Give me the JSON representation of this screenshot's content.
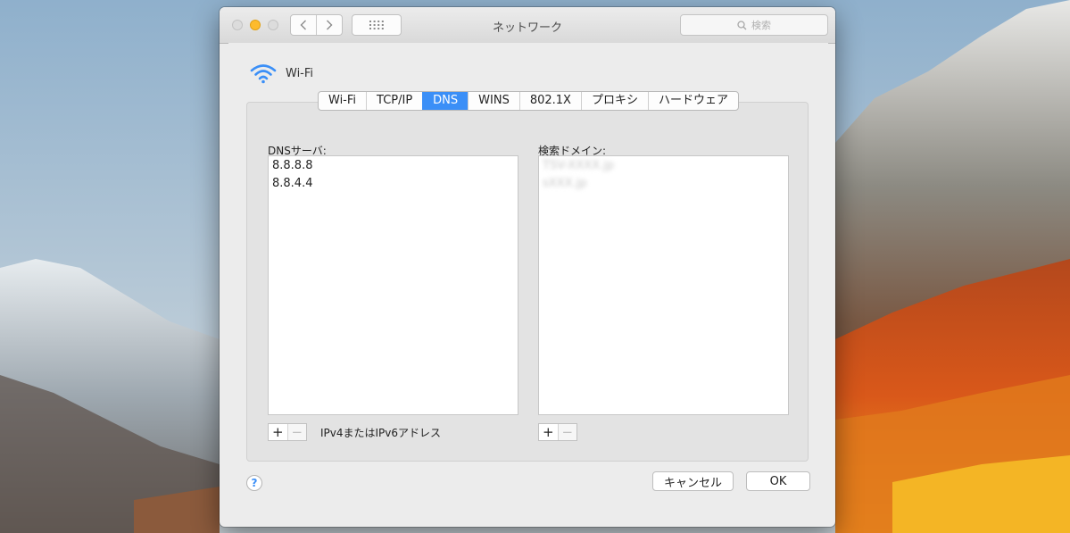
{
  "window": {
    "title": "ネットワーク"
  },
  "toolbar": {
    "back_icon": "chevron-left-icon",
    "forward_icon": "chevron-right-icon",
    "show_all_icon": "grid-icon"
  },
  "search": {
    "placeholder": "検索"
  },
  "interface": {
    "name": "Wi-Fi",
    "icon": "wifi-icon"
  },
  "tabs": [
    "Wi-Fi",
    "TCP/IP",
    "DNS",
    "WINS",
    "802.1X",
    "プロキシ",
    "ハードウェア"
  ],
  "active_tab": "DNS",
  "dns": {
    "label": "DNSサーバ:",
    "servers": [
      "8.8.8.8",
      "8.8.4.4"
    ],
    "add_label": "+",
    "remove_label": "−",
    "hint": "IPv4またはIPv6アドレス"
  },
  "search_domains": {
    "label": "検索ドメイン:",
    "domains": [
      "TSV-XXXX.jp",
      "sXXX.jp"
    ],
    "add_label": "+",
    "remove_label": "−"
  },
  "footer": {
    "help": "?",
    "cancel": "キャンセル",
    "ok": "OK"
  },
  "colors": {
    "accent": "#3b8ff7",
    "minimize": "#fdbb2d"
  }
}
